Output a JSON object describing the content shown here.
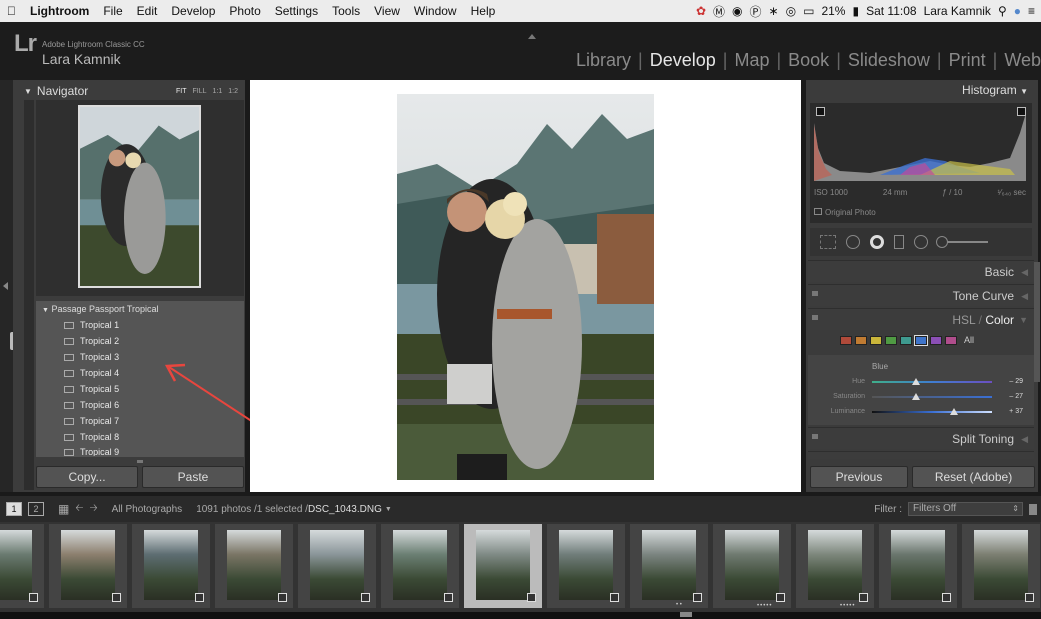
{
  "menubar": {
    "apple": "",
    "app": "Lightroom",
    "items": [
      "File",
      "Edit",
      "Develop",
      "Photo",
      "Settings",
      "Tools",
      "View",
      "Window",
      "Help"
    ],
    "battery": "21%",
    "clock": "Sat 11:08",
    "user": "Lara Kamnik"
  },
  "header": {
    "logo": "Lr",
    "product": "Adobe Lightroom Classic CC",
    "user": "Lara Kamnik",
    "modules": [
      "Library",
      "Develop",
      "Map",
      "Book",
      "Slideshow",
      "Print",
      "Web"
    ],
    "active_module": "Develop"
  },
  "navigator": {
    "title": "Navigator",
    "zoom": [
      "FIT",
      "FILL",
      "1:1",
      "1:2"
    ]
  },
  "presets": {
    "group": "Passage Passport Tropical",
    "items": [
      "Tropical 1",
      "Tropical 2",
      "Tropical 3",
      "Tropical 4",
      "Tropical 5",
      "Tropical 6",
      "Tropical 7",
      "Tropical 8",
      "Tropical 9"
    ]
  },
  "buttons": {
    "copy": "Copy...",
    "paste": "Paste",
    "previous": "Previous",
    "reset": "Reset (Adobe)"
  },
  "histogram": {
    "title": "Histogram",
    "iso": "ISO 1000",
    "focal": "24 mm",
    "aperture": "ƒ / 10",
    "shutter": "¹⁄₆₄₀ sec",
    "original": "Original Photo"
  },
  "sections": {
    "basic": "Basic",
    "tone_curve": "Tone Curve",
    "hsl_a": "HSL",
    "hsl_sep": " / ",
    "hsl_b": "Color",
    "split_toning": "Split Toning"
  },
  "hsl": {
    "all_label": "All",
    "swatches": [
      "#b04a3a",
      "#c07b32",
      "#c9b53a",
      "#4f9a43",
      "#3e9a8f",
      "#3f74c9",
      "#8b4fb5",
      "#b04d8c"
    ],
    "color_name": "Blue",
    "hue_label": "Hue",
    "hue_value": "– 29",
    "hue_level": 0.37,
    "sat_label": "Saturation",
    "sat_value": "– 27",
    "sat_level": 0.37,
    "lum_label": "Luminance",
    "lum_value": "+ 37",
    "lum_level": 0.68
  },
  "filmbar": {
    "view1": "1",
    "view2": "2",
    "source": "All Photographs",
    "count": "1091 photos /1 selected /",
    "file": "DSC_1043.DNG",
    "filter_label": "Filter :",
    "filter_value": "Filters Off"
  },
  "filmstrip": {
    "selected_index": 6,
    "stars": [
      "",
      "",
      "",
      "",
      "",
      "",
      "",
      "",
      "•••••",
      "•••••",
      "",
      ""
    ],
    "dots_under_selected": "• •"
  },
  "colors": {
    "panel": "#3c3c3c",
    "active_text": "#e6e6e6",
    "arrow": "#e8463e"
  }
}
